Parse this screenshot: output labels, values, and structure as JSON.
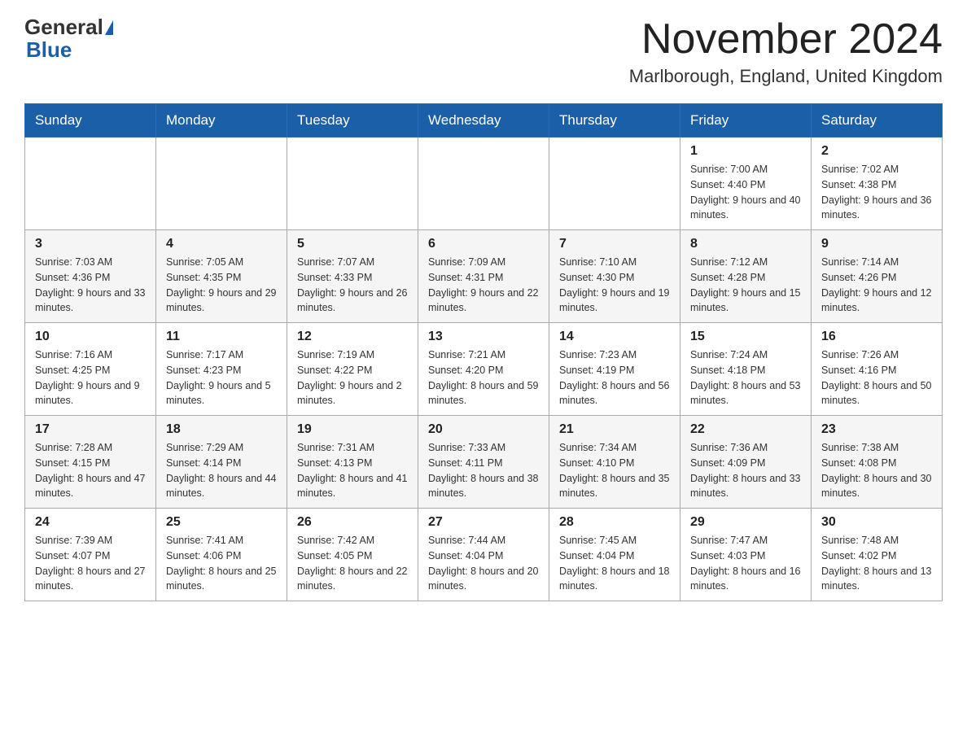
{
  "header": {
    "logo_general": "General",
    "logo_blue": "Blue",
    "month_title": "November 2024",
    "location": "Marlborough, England, United Kingdom"
  },
  "weekdays": [
    "Sunday",
    "Monday",
    "Tuesday",
    "Wednesday",
    "Thursday",
    "Friday",
    "Saturday"
  ],
  "rows": [
    {
      "cells": [
        {
          "day": "",
          "info": ""
        },
        {
          "day": "",
          "info": ""
        },
        {
          "day": "",
          "info": ""
        },
        {
          "day": "",
          "info": ""
        },
        {
          "day": "",
          "info": ""
        },
        {
          "day": "1",
          "info": "Sunrise: 7:00 AM\nSunset: 4:40 PM\nDaylight: 9 hours and 40 minutes."
        },
        {
          "day": "2",
          "info": "Sunrise: 7:02 AM\nSunset: 4:38 PM\nDaylight: 9 hours and 36 minutes."
        }
      ]
    },
    {
      "cells": [
        {
          "day": "3",
          "info": "Sunrise: 7:03 AM\nSunset: 4:36 PM\nDaylight: 9 hours and 33 minutes."
        },
        {
          "day": "4",
          "info": "Sunrise: 7:05 AM\nSunset: 4:35 PM\nDaylight: 9 hours and 29 minutes."
        },
        {
          "day": "5",
          "info": "Sunrise: 7:07 AM\nSunset: 4:33 PM\nDaylight: 9 hours and 26 minutes."
        },
        {
          "day": "6",
          "info": "Sunrise: 7:09 AM\nSunset: 4:31 PM\nDaylight: 9 hours and 22 minutes."
        },
        {
          "day": "7",
          "info": "Sunrise: 7:10 AM\nSunset: 4:30 PM\nDaylight: 9 hours and 19 minutes."
        },
        {
          "day": "8",
          "info": "Sunrise: 7:12 AM\nSunset: 4:28 PM\nDaylight: 9 hours and 15 minutes."
        },
        {
          "day": "9",
          "info": "Sunrise: 7:14 AM\nSunset: 4:26 PM\nDaylight: 9 hours and 12 minutes."
        }
      ]
    },
    {
      "cells": [
        {
          "day": "10",
          "info": "Sunrise: 7:16 AM\nSunset: 4:25 PM\nDaylight: 9 hours and 9 minutes."
        },
        {
          "day": "11",
          "info": "Sunrise: 7:17 AM\nSunset: 4:23 PM\nDaylight: 9 hours and 5 minutes."
        },
        {
          "day": "12",
          "info": "Sunrise: 7:19 AM\nSunset: 4:22 PM\nDaylight: 9 hours and 2 minutes."
        },
        {
          "day": "13",
          "info": "Sunrise: 7:21 AM\nSunset: 4:20 PM\nDaylight: 8 hours and 59 minutes."
        },
        {
          "day": "14",
          "info": "Sunrise: 7:23 AM\nSunset: 4:19 PM\nDaylight: 8 hours and 56 minutes."
        },
        {
          "day": "15",
          "info": "Sunrise: 7:24 AM\nSunset: 4:18 PM\nDaylight: 8 hours and 53 minutes."
        },
        {
          "day": "16",
          "info": "Sunrise: 7:26 AM\nSunset: 4:16 PM\nDaylight: 8 hours and 50 minutes."
        }
      ]
    },
    {
      "cells": [
        {
          "day": "17",
          "info": "Sunrise: 7:28 AM\nSunset: 4:15 PM\nDaylight: 8 hours and 47 minutes."
        },
        {
          "day": "18",
          "info": "Sunrise: 7:29 AM\nSunset: 4:14 PM\nDaylight: 8 hours and 44 minutes."
        },
        {
          "day": "19",
          "info": "Sunrise: 7:31 AM\nSunset: 4:13 PM\nDaylight: 8 hours and 41 minutes."
        },
        {
          "day": "20",
          "info": "Sunrise: 7:33 AM\nSunset: 4:11 PM\nDaylight: 8 hours and 38 minutes."
        },
        {
          "day": "21",
          "info": "Sunrise: 7:34 AM\nSunset: 4:10 PM\nDaylight: 8 hours and 35 minutes."
        },
        {
          "day": "22",
          "info": "Sunrise: 7:36 AM\nSunset: 4:09 PM\nDaylight: 8 hours and 33 minutes."
        },
        {
          "day": "23",
          "info": "Sunrise: 7:38 AM\nSunset: 4:08 PM\nDaylight: 8 hours and 30 minutes."
        }
      ]
    },
    {
      "cells": [
        {
          "day": "24",
          "info": "Sunrise: 7:39 AM\nSunset: 4:07 PM\nDaylight: 8 hours and 27 minutes."
        },
        {
          "day": "25",
          "info": "Sunrise: 7:41 AM\nSunset: 4:06 PM\nDaylight: 8 hours and 25 minutes."
        },
        {
          "day": "26",
          "info": "Sunrise: 7:42 AM\nSunset: 4:05 PM\nDaylight: 8 hours and 22 minutes."
        },
        {
          "day": "27",
          "info": "Sunrise: 7:44 AM\nSunset: 4:04 PM\nDaylight: 8 hours and 20 minutes."
        },
        {
          "day": "28",
          "info": "Sunrise: 7:45 AM\nSunset: 4:04 PM\nDaylight: 8 hours and 18 minutes."
        },
        {
          "day": "29",
          "info": "Sunrise: 7:47 AM\nSunset: 4:03 PM\nDaylight: 8 hours and 16 minutes."
        },
        {
          "day": "30",
          "info": "Sunrise: 7:48 AM\nSunset: 4:02 PM\nDaylight: 8 hours and 13 minutes."
        }
      ]
    }
  ]
}
